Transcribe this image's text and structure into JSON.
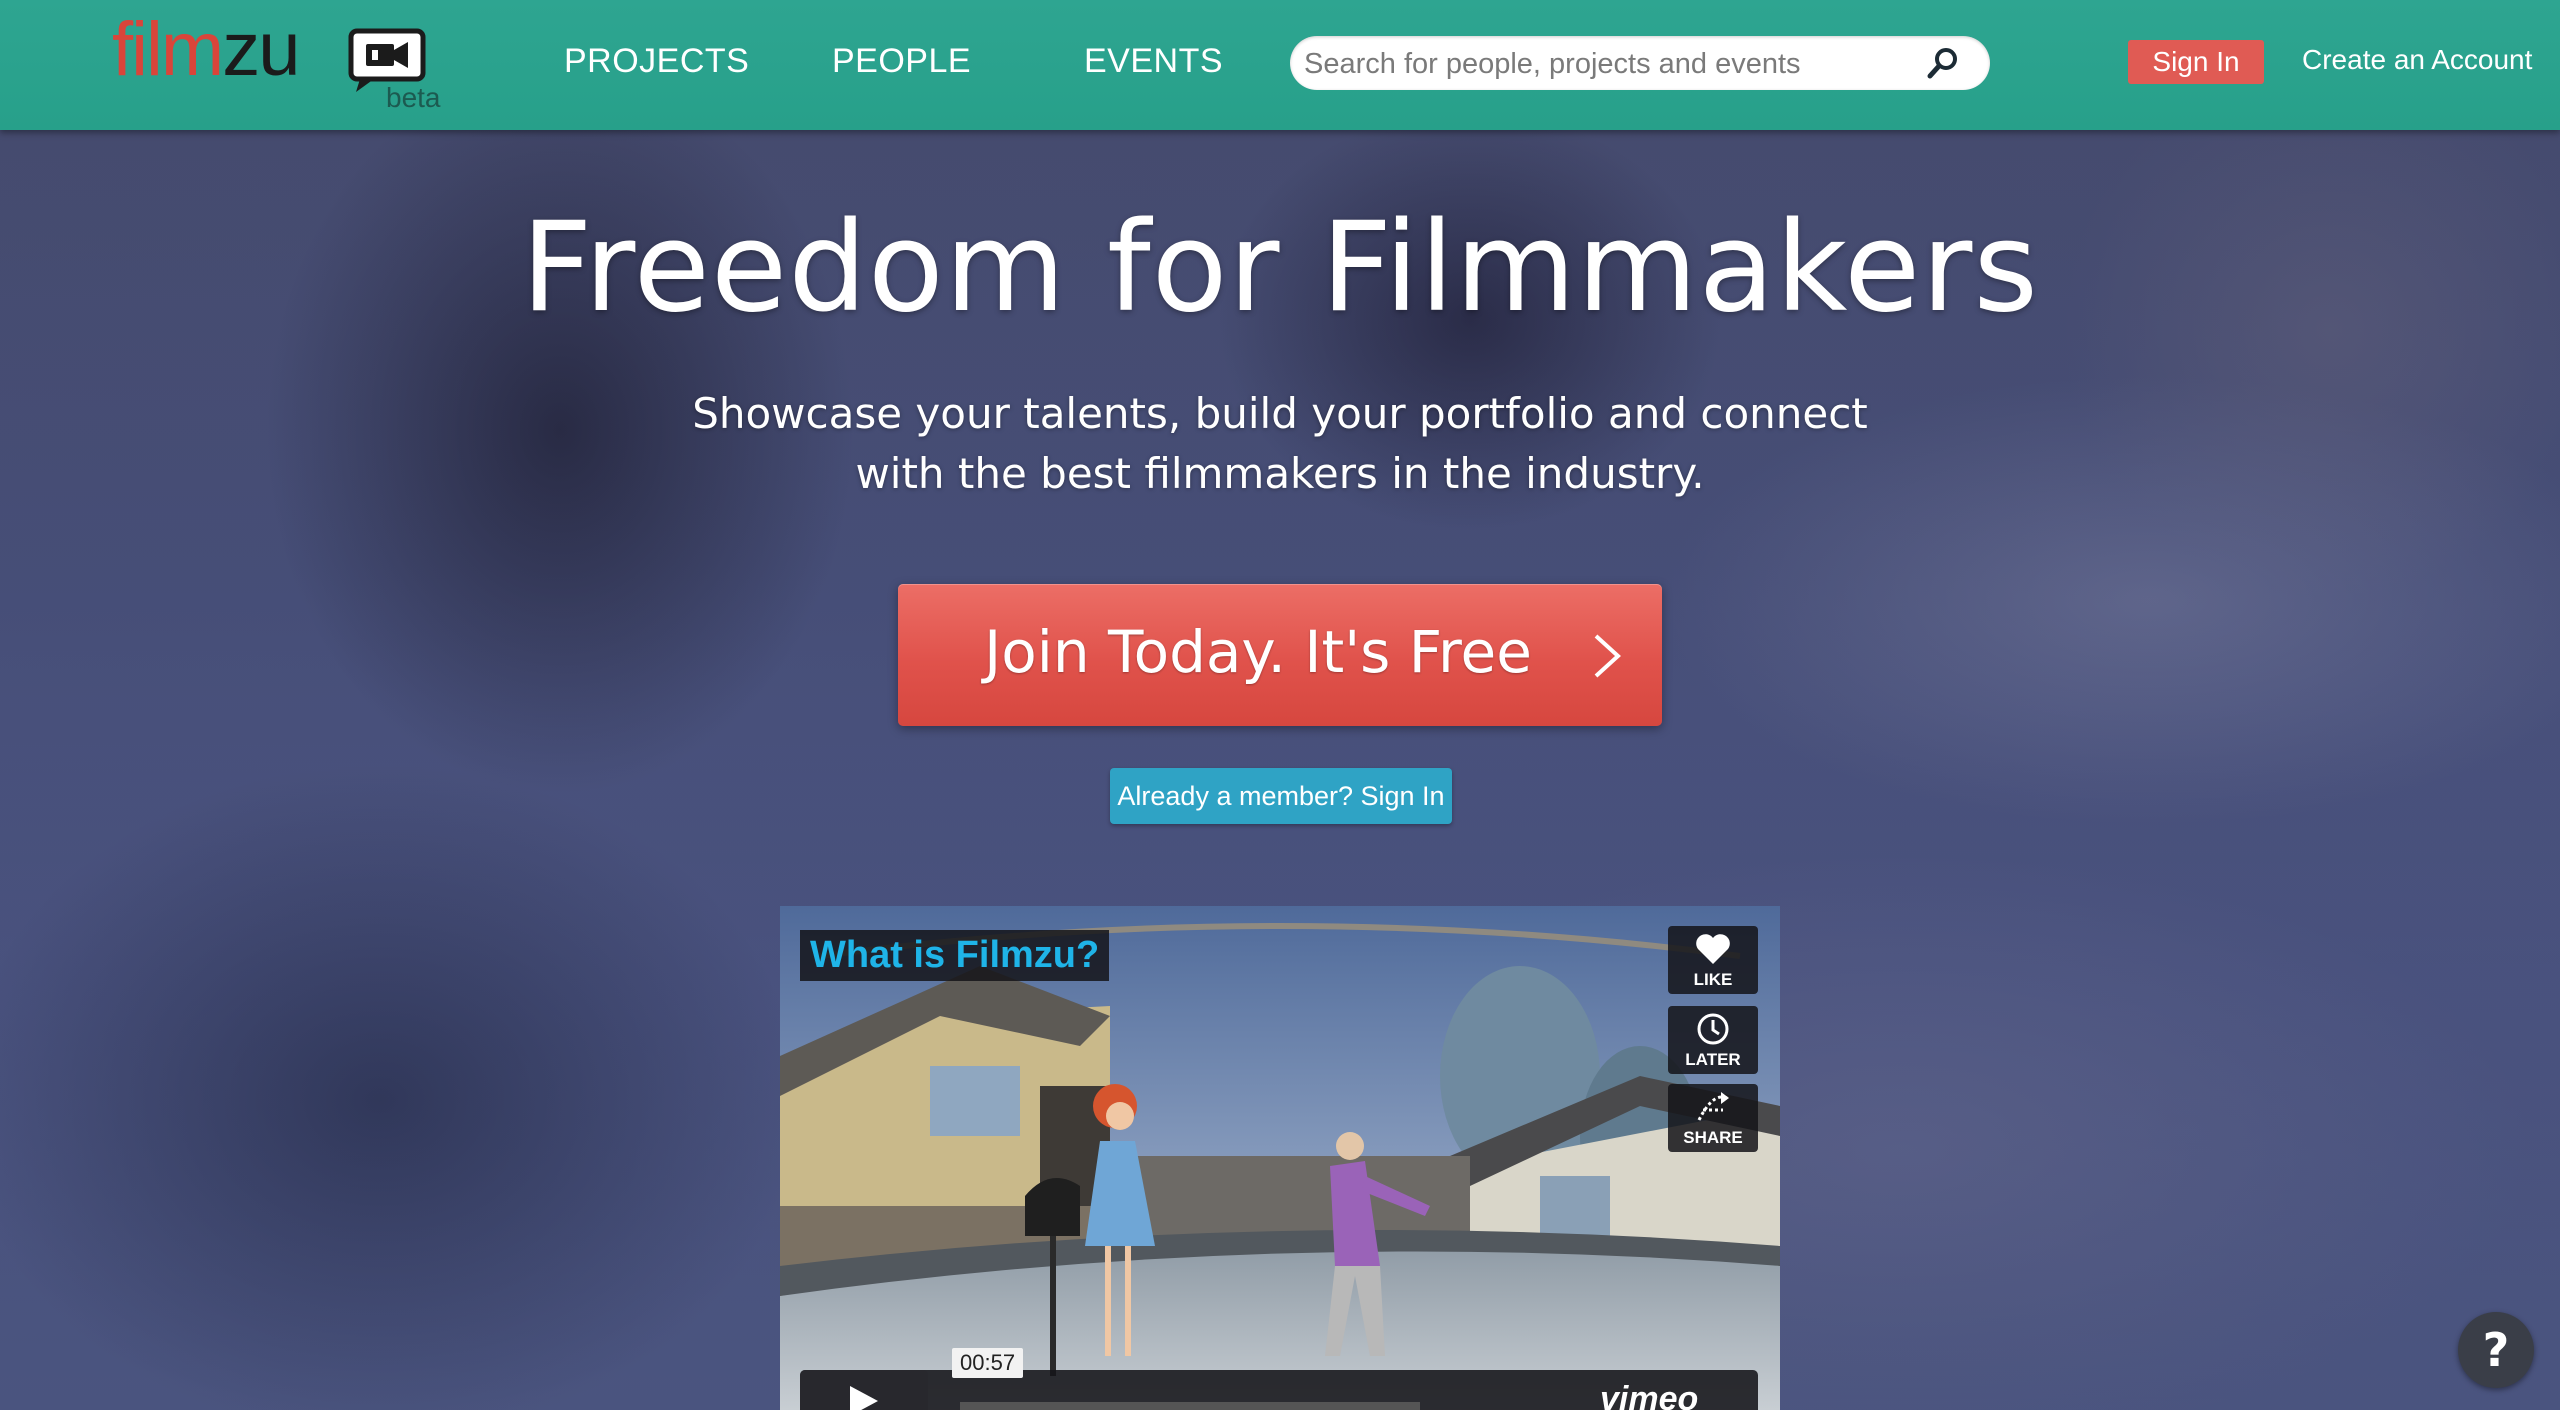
{
  "header": {
    "logo": {
      "word_red": "film",
      "word_black": "zu",
      "badge": "beta"
    },
    "nav": [
      {
        "label": "PROJECTS"
      },
      {
        "label": "PEOPLE"
      },
      {
        "label": "EVENTS"
      }
    ],
    "search": {
      "placeholder": "Search for people, projects and events",
      "icon": "search-icon"
    },
    "sign_in_label": "Sign In",
    "create_account_label": "Create an Account"
  },
  "hero": {
    "title": "Freedom for Filmmakers",
    "subtitle_line1": "Showcase your talents, build your portfolio and connect",
    "subtitle_line2": "with the best filmmakers in the industry.",
    "cta_label": "Join Today. It's Free",
    "member_label": "Already a member? Sign In"
  },
  "video": {
    "title": "What is Filmzu?",
    "actions": [
      {
        "label": "LIKE",
        "icon": "heart-icon"
      },
      {
        "label": "LATER",
        "icon": "clock-icon"
      },
      {
        "label": "SHARE",
        "icon": "share-icon"
      }
    ],
    "duration": "00:57",
    "provider": "vimeo"
  },
  "help": {
    "label": "?"
  },
  "colors": {
    "header": "#2ea591",
    "cta": "#e0524b",
    "member_button": "#2fa3c5",
    "sign_in": "#e05b54",
    "video_title": "#1fb4e8"
  }
}
